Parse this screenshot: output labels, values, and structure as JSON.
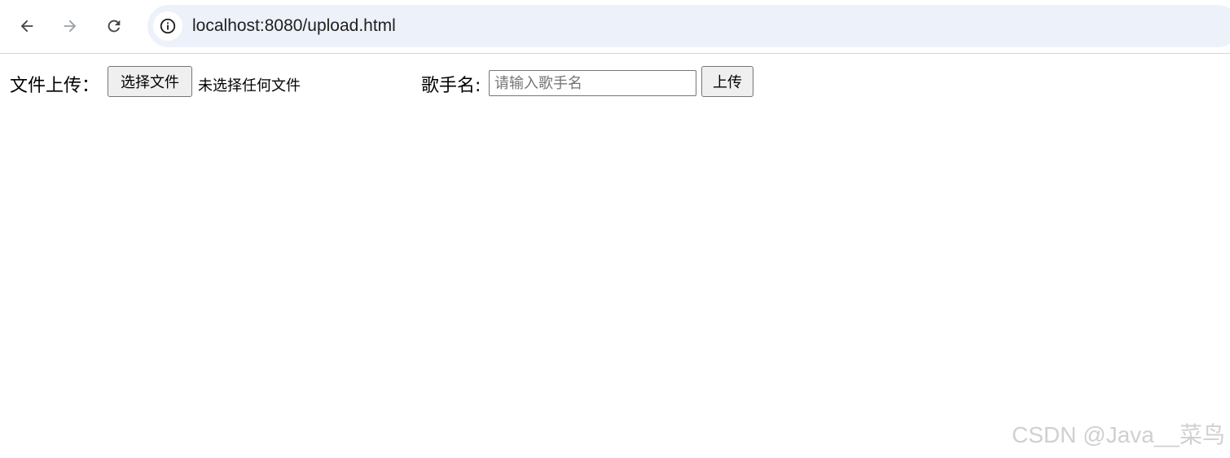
{
  "browser": {
    "url": "localhost:8080/upload.html",
    "icons": {
      "back": "arrow-left-icon",
      "forward": "arrow-right-icon",
      "reload": "reload-icon",
      "site_info": "info-icon"
    },
    "colors": {
      "omnibox_bg": "#edf2fa",
      "forward_disabled": "#9aa0a6"
    }
  },
  "form": {
    "file_label": "文件上传：",
    "choose_file_button": "选择文件",
    "no_file_text": "未选择任何文件",
    "singer_label": "歌手名:",
    "singer_input_value": "",
    "singer_input_placeholder": "请输入歌手名",
    "upload_button": "上传"
  },
  "watermark": "CSDN @Java__菜鸟"
}
